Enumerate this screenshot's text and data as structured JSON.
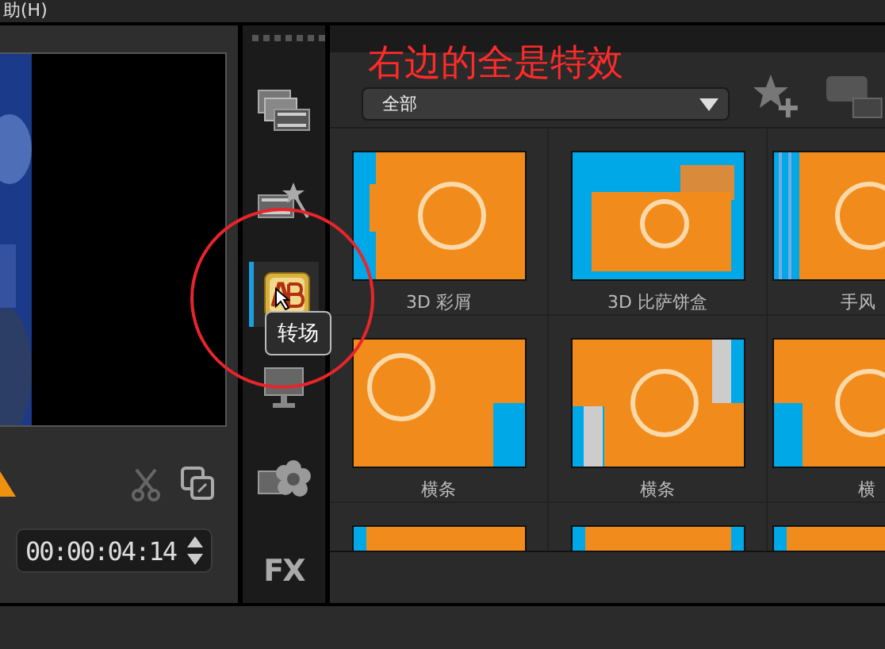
{
  "menu": {
    "label": "助(H)"
  },
  "preview": {
    "timecode": "00:00:04:14"
  },
  "library_tabs": [
    {
      "kind": "media",
      "selected": false
    },
    {
      "kind": "instant",
      "selected": false
    },
    {
      "kind": "transition",
      "selected": true
    },
    {
      "kind": "title",
      "selected": false
    },
    {
      "kind": "graphic",
      "selected": false
    },
    {
      "kind": "filter",
      "label": "FX",
      "selected": false
    }
  ],
  "tooltip": {
    "text": "转场"
  },
  "filter": {
    "category": "全部"
  },
  "annotation": {
    "text": "右边的全是特效"
  },
  "tiles": [
    {
      "kind": "confetti",
      "label": "3D 彩屑"
    },
    {
      "kind": "pizza",
      "label": "3D 比萨饼盒"
    },
    {
      "kind": "accordion",
      "label": "手风"
    },
    {
      "kind": "bar-right",
      "label": "横条"
    },
    {
      "kind": "bar-pair",
      "label": "横条"
    },
    {
      "kind": "bar-left",
      "label": "横"
    },
    {
      "kind": "strip-left"
    },
    {
      "kind": "strip-both"
    },
    {
      "kind": "strip-left"
    }
  ]
}
